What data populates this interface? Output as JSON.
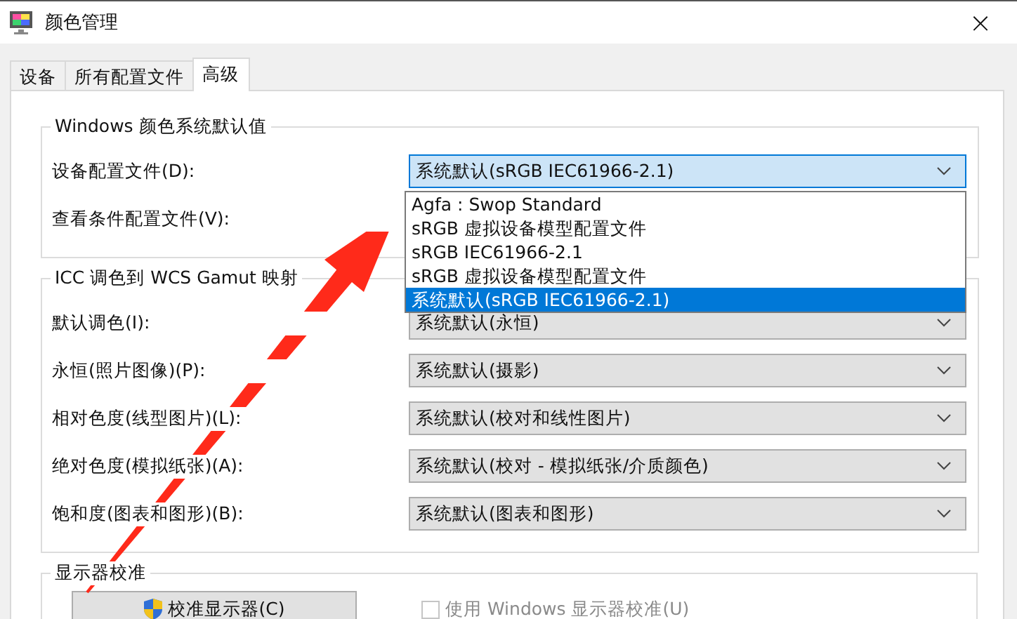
{
  "window": {
    "title": "颜色管理",
    "close": "×"
  },
  "tabs": [
    {
      "label": "设备",
      "selected": false
    },
    {
      "label": "所有配置文件",
      "selected": false
    },
    {
      "label": "高级",
      "selected": true
    }
  ],
  "groups": [
    {
      "title": "Windows 颜色系统默认值",
      "rows": [
        {
          "label": "设备配置文件(D):",
          "value": "系统默认(sRGB IEC61966-2.1)",
          "open": true
        },
        {
          "label": "查看条件配置文件(V):"
        }
      ]
    },
    {
      "title": "ICC 调色到 WCS Gamut 映射",
      "rows": [
        {
          "label": "默认调色(I):",
          "value": "系统默认(永恒)",
          "open": false
        },
        {
          "label": "永恒(照片图像)(P):",
          "value": "系统默认(摄影)",
          "open": false
        },
        {
          "label": "相对色度(线型图片)(L):",
          "value": "系统默认(校对和线性图片)",
          "open": false
        },
        {
          "label": "绝对色度(模拟纸张)(A):",
          "value": "系统默认(校对 - 模拟纸张/介质颜色)",
          "open": false
        },
        {
          "label": "饱和度(图表和图形)(B):",
          "value": "系统默认(图表和图形)",
          "open": false
        }
      ]
    }
  ],
  "dropdown_list": [
    {
      "label": "Agfa : Swop Standard",
      "selected": false
    },
    {
      "label": "sRGB 虚拟设备模型配置文件",
      "selected": false
    },
    {
      "label": "sRGB IEC61966-2.1",
      "selected": false
    },
    {
      "label": "sRGB 虚拟设备模型配置文件",
      "selected": false
    },
    {
      "label": "系统默认(sRGB IEC61966-2.1)",
      "selected": true
    }
  ],
  "calibration": {
    "title": "显示器校准",
    "button": "校准显示器(C)",
    "checkbox": {
      "label": "使用 Windows 显示器校准(U)",
      "checked": false,
      "disabled": true
    }
  }
}
